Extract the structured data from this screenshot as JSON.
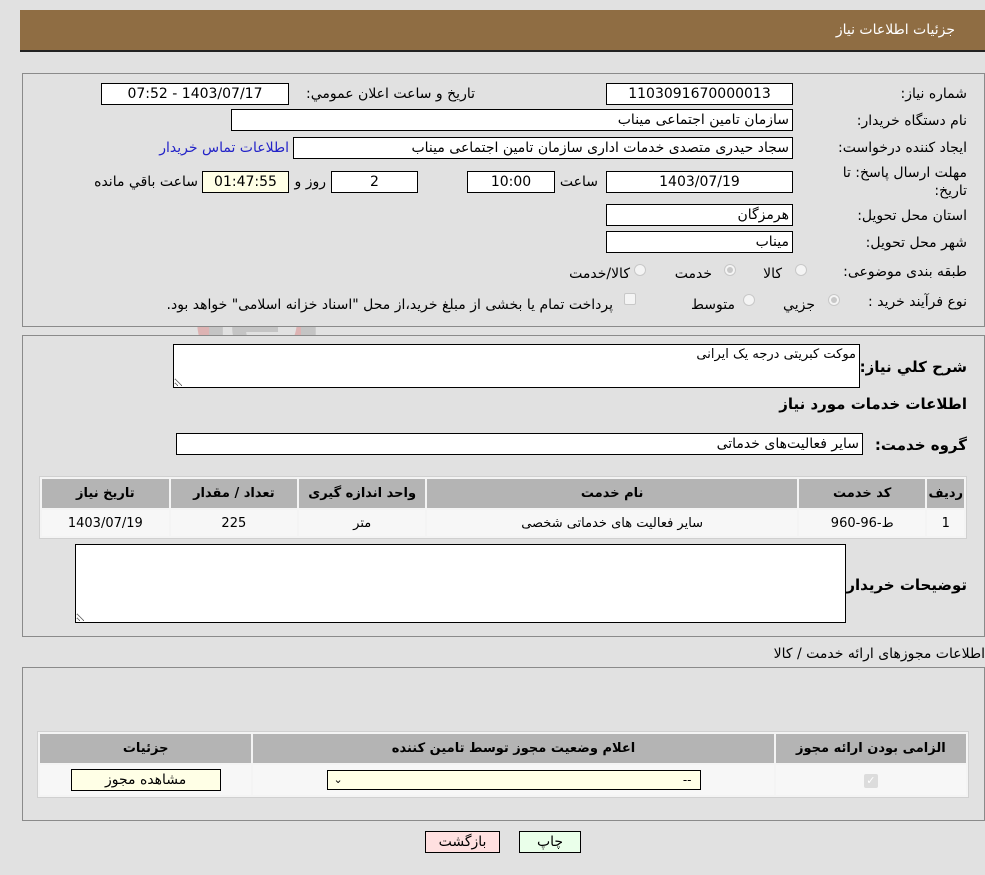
{
  "header": {
    "title": "جزئیات اطلاعات نیاز"
  },
  "info": {
    "need_number_label": "شماره نیاز:",
    "need_number": "1103091670000013",
    "announce_label": "تاریخ و ساعت اعلان عمومي:",
    "announce_value": "1403/07/17 - 07:52",
    "buyer_org_label": "نام دستگاه خریدار:",
    "buyer_org": "سازمان تامین اجتماعی میناب",
    "creator_label": "ایجاد کننده درخواست:",
    "creator": "سجاد حیدری متصدی خدمات اداری سازمان تامین اجتماعی میناب",
    "contact_link": "اطلاعات تماس خریدار",
    "deadline_label_1": "مهلت ارسال پاسخ: تا",
    "deadline_label_2": "تاریخ:",
    "deadline_date": "1403/07/19",
    "time_label": "ساعت",
    "deadline_time": "10:00",
    "days_value": "2",
    "days_label": "روز و",
    "remaining_time": "01:47:55",
    "remaining_label": "ساعت باقي مانده",
    "province_label": "استان محل تحویل:",
    "province": "هرمزگان",
    "city_label": "شهر محل تحویل:",
    "city": "میناب",
    "category_label": "طبقه بندی موضوعی:",
    "category_options": [
      {
        "label": "کالا",
        "checked": false
      },
      {
        "label": "خدمت",
        "checked": true
      },
      {
        "label": "کالا/خدمت",
        "checked": false
      }
    ],
    "purchase_type_label": "نوع فرآیند خرید :",
    "purchase_type_options": [
      {
        "label": "جزیي",
        "checked": true
      },
      {
        "label": "متوسط",
        "checked": false
      }
    ],
    "treasury_note": "پرداخت تمام یا بخشی از مبلغ خرید،از محل \"اسناد خزانه اسلامی\" خواهد بود.",
    "treasury_checked": false
  },
  "need": {
    "description_label": "شرح کلي نیاز:",
    "description": "موکت کبریتی درجه یک ایرانی",
    "services_heading": "اطلاعات خدمات مورد نیاز",
    "service_group_label": "گروه خدمت:",
    "service_group": "سایر فعالیت‌های خدماتی",
    "table": {
      "headers": [
        "ردیف",
        "کد خدمت",
        "نام خدمت",
        "واحد اندازه گیری",
        "تعداد / مقدار",
        "تاریخ نیاز"
      ],
      "rows": [
        [
          "1",
          "ط-96-960",
          "سایر فعالیت های خدماتی شخصی",
          "متر",
          "225",
          "1403/07/19"
        ]
      ]
    },
    "buyer_notes_label": "توضیحات خریدار:",
    "buyer_notes": ""
  },
  "permits": {
    "section_title": "اطلاعات مجوزهای ارائه خدمت / کالا",
    "headers": [
      "الزامی بودن ارائه مجوز",
      "اعلام وضعیت مجوز توسط تامین کننده",
      "جزئیات"
    ],
    "row": {
      "required_checked": true,
      "status_value": "--",
      "details_button": "مشاهده مجوز"
    }
  },
  "buttons": {
    "print": "چاپ",
    "back": "بازگشت"
  },
  "watermark": {
    "text": "AriaTender.neT"
  },
  "colors": {
    "header_bg": "#8f6d43",
    "link": "#2323c8",
    "print_bg": "#eaffea",
    "back_bg": "#ffe0e0",
    "yellow_field": "#ffffe6"
  }
}
